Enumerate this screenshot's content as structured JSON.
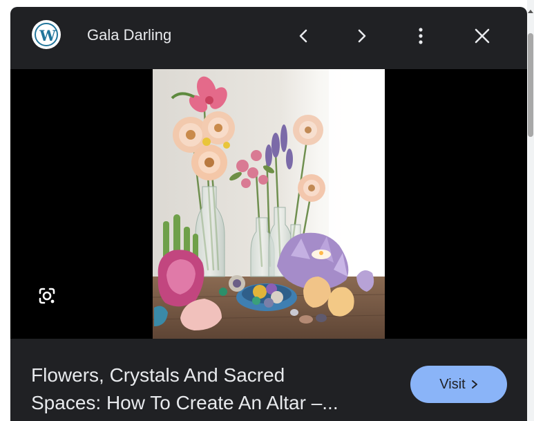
{
  "header": {
    "favicon_letter": "W",
    "site_name": "Gala Darling",
    "prev_icon": "chevron-left-icon",
    "next_icon": "chevron-right-icon",
    "more_icon": "more-vert-icon",
    "close_icon": "close-icon"
  },
  "preview": {
    "lens_icon": "google-lens-icon",
    "colors": {
      "panel_bg": "#202124",
      "image_bg": "#000000",
      "accent": "#8ab4f8",
      "text": "#e8eaed"
    }
  },
  "result": {
    "title_line_1": "Flowers, Crystals And Sacred",
    "title_line_2": "Spaces: How To Create An Altar –...",
    "visit_label": "Visit",
    "visit_icon": "chevron-right-icon"
  }
}
